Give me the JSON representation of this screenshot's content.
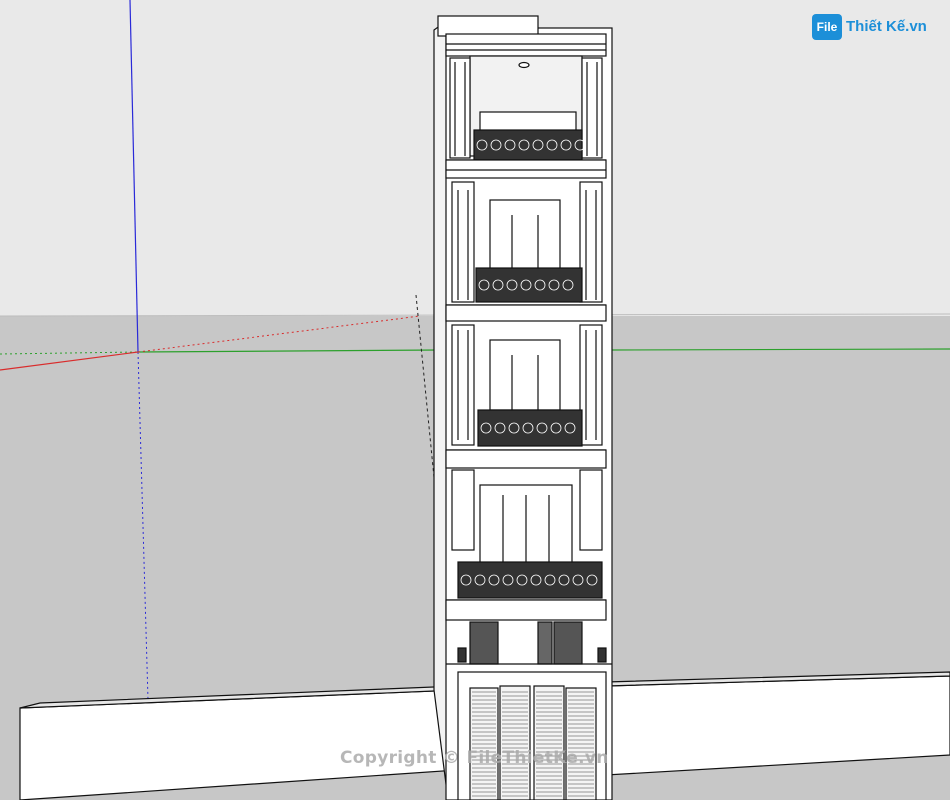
{
  "app": {
    "viewport_label": "SketchUp 3D model viewport"
  },
  "branding": {
    "badge_text": "File",
    "name_text": "Thiết Kế.vn",
    "brand_color": "#1c8fd8"
  },
  "watermark": {
    "text": "Copyright © FileThietKe.vn"
  },
  "colors": {
    "sky": "#e9e9e9",
    "ground": "#c7c7c7",
    "axis_blue": "#2a2ad8",
    "axis_green": "#2ca02c",
    "axis_red": "#d92c2c",
    "line": "#111111"
  }
}
